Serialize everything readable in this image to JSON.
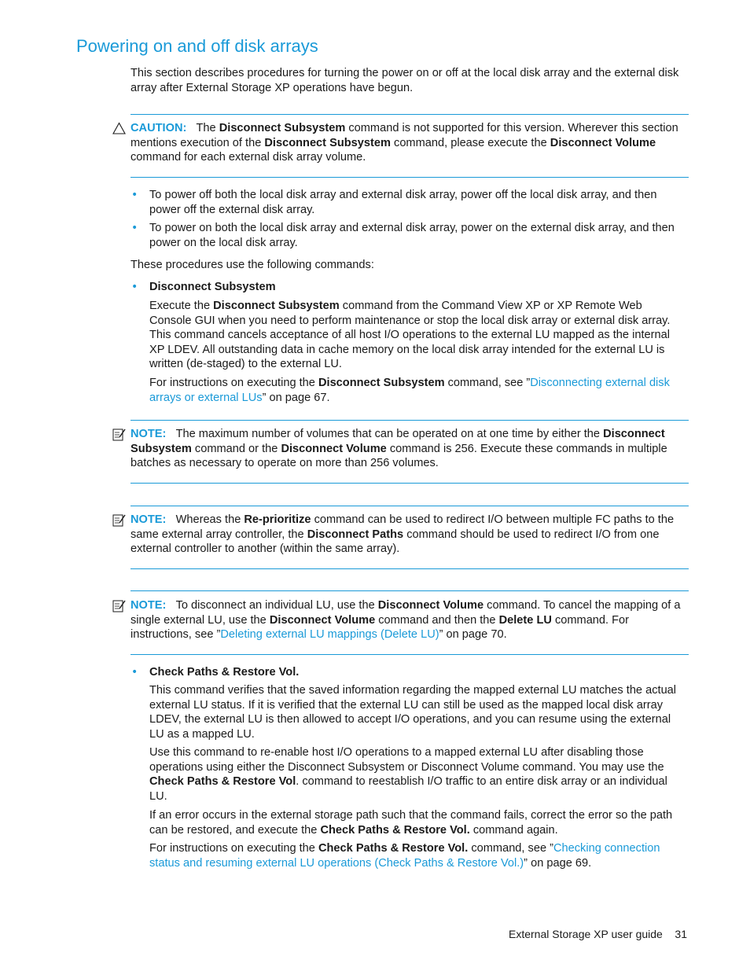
{
  "title": "Powering on and off disk arrays",
  "intro": "This section describes procedures for turning the power on or off at the local disk array and the external disk array after External Storage XP operations have begun.",
  "caution": {
    "label": "CAUTION:",
    "t1": "The ",
    "b1": "Disconnect Subsystem",
    "t2": " command is not supported for this version. Wherever this section mentions execution of the ",
    "b2": "Disconnect Subsystem",
    "t3": " command, please execute the ",
    "b3": "Disconnect Volume",
    "t4": " command for each external disk array volume."
  },
  "power_bullets": [
    "To power off both the local disk array and external disk array, power off the local disk array, and then power off the external disk array.",
    "To power on both the local disk array and external disk array, power on the external disk array, and then power on the local disk array."
  ],
  "commands_intro": "These procedures use the following commands:",
  "disconnect": {
    "heading": "Disconnect Subsystem",
    "p1_t1": "Execute the ",
    "p1_b1": "Disconnect Subsystem",
    "p1_t2": " command from the Command View XP or XP Remote Web Console GUI when you need to perform maintenance or stop the local disk array or external disk array. This command cancels acceptance of all host I/O operations to the external LU mapped as the internal XP LDEV. All outstanding data in cache memory on the local disk array intended for the external LU is written (de-staged) to the external LU.",
    "p2_t1": "For instructions on executing the ",
    "p2_b1": "Disconnect Subsystem",
    "p2_t2": " command, see ”",
    "p2_link": "Disconnecting external disk arrays or external LUs",
    "p2_t3": "” on page 67."
  },
  "note1": {
    "label": "NOTE:",
    "t1": "The maximum number of volumes that can be operated on at one time by either the ",
    "b1": "Disconnect Subsystem",
    "t2": " command or the ",
    "b2": "Disconnect Volume",
    "t3": " command is 256. Execute these commands in multiple batches as necessary to operate on more than 256 volumes."
  },
  "note2": {
    "label": "NOTE:",
    "t1": "Whereas the ",
    "b1": "Re-prioritize",
    "t2": " command can be used to redirect I/O between multiple FC paths to the same external array controller, the ",
    "b2": "Disconnect Paths",
    "t3": " command should be used to redirect I/O from one external controller to another (within the same array)."
  },
  "note3": {
    "label": "NOTE:",
    "t1": "To disconnect an individual LU, use the ",
    "b1": "Disconnect Volume",
    "t2": " command. To cancel the mapping of a single external LU, use the ",
    "b2": "Disconnect Volume",
    "t3": " command and then the ",
    "b3": "Delete LU",
    "t4": " command. For instructions, see ”",
    "link": "Deleting external LU mappings (Delete LU)",
    "t5": "” on page 70."
  },
  "check": {
    "heading": "Check Paths & Restore Vol.",
    "p1": "This command verifies that the saved information regarding the mapped external LU matches the actual external LU status. If it is verified that the external LU can still be used as the mapped local disk array LDEV, the external LU is then allowed to accept I/O operations, and you can resume using the external LU as a mapped LU.",
    "p2_t1": "Use this command to re-enable host I/O operations to a mapped external LU after disabling those operations using either the Disconnect Subsystem or Disconnect Volume command. You may use the ",
    "p2_b1": "Check Paths & Restore Vol",
    "p2_t2": ". command to reestablish I/O traffic to an entire disk array or an individual LU.",
    "p3_t1": "If an error occurs in the external storage path such that the command fails, correct the error so the path can be restored, and execute the ",
    "p3_b1": "Check Paths & Restore Vol.",
    "p3_t2": " command again.",
    "p4_t1": "For instructions on executing the ",
    "p4_b1": "Check Paths & Restore Vol.",
    "p4_t2": " command, see ”",
    "p4_link": "Checking connection status and resuming external LU operations (Check Paths & Restore Vol.)",
    "p4_t3": "” on page 69."
  },
  "footer": {
    "guide": "External Storage XP user guide",
    "page": "31"
  },
  "colors": {
    "accent": "#1a9ad8",
    "text": "#1a1a1a"
  }
}
